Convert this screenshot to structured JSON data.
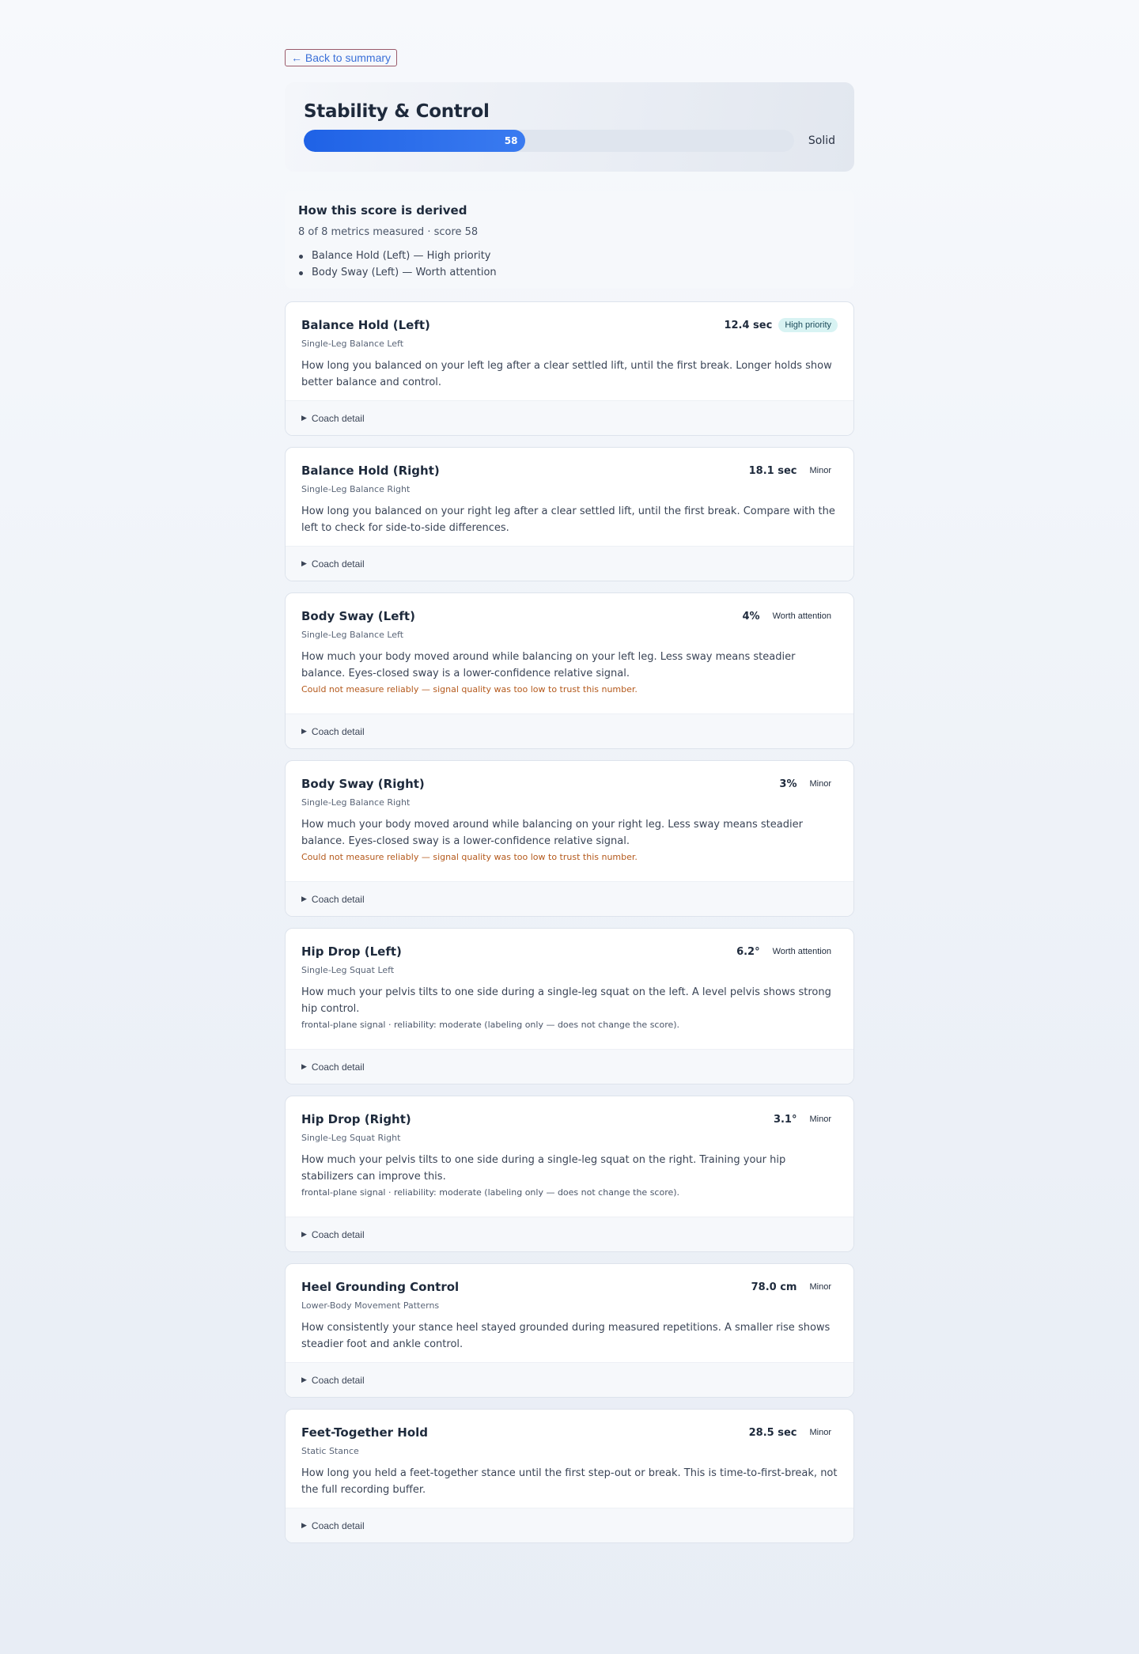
{
  "nav": {
    "back_label": "← Back to summary"
  },
  "hero": {
    "title": "Stability & Control",
    "score": 58,
    "score_label": "58",
    "score_fraction": 0.58,
    "rating": "Solid",
    "bar_color": "#2a6ae8"
  },
  "derived": {
    "title": "How this score is derived",
    "summary": "8 of 8 metrics measured · score 58",
    "items": [
      "Balance Hold (Left) — High priority",
      "Body Sway (Left) — Worth attention"
    ]
  },
  "coach_label": "Coach detail",
  "metrics": [
    {
      "title": "Balance Hold (Left)",
      "value": "12.4 sec",
      "badge": "High priority",
      "source": "Single-Leg Balance Left",
      "description": "How long you balanced on your left leg after a clear settled lift, until the first break. Longer holds show better balance and control."
    },
    {
      "title": "Balance Hold (Right)",
      "value": "18.1 sec",
      "badge": "Minor",
      "source": "Single-Leg Balance Right",
      "description": "How long you balanced on your right leg after a clear settled lift, until the first break. Compare with the left to check for side-to-side differences."
    },
    {
      "title": "Body Sway (Left)",
      "value": "4%",
      "badge": "Worth attention",
      "source": "Single-Leg Balance Left",
      "description": "How much your body moved around while balancing on your left leg. Less sway means steadier balance. Eyes-closed sway is a lower-confidence relative signal.",
      "warning": "Could not measure reliably — signal quality was too low to trust this number."
    },
    {
      "title": "Body Sway (Right)",
      "value": "3%",
      "badge": "Minor",
      "source": "Single-Leg Balance Right",
      "description": "How much your body moved around while balancing on your right leg. Less sway means steadier balance. Eyes-closed sway is a lower-confidence relative signal.",
      "warning": "Could not measure reliably — signal quality was too low to trust this number."
    },
    {
      "title": "Hip Drop (Left)",
      "value": "6.2°",
      "badge": "Worth attention",
      "source": "Single-Leg Squat Left",
      "description": "How much your pelvis tilts to one side during a single-leg squat on the left. A level pelvis shows strong hip control.",
      "note": "frontal-plane signal · reliability: moderate (labeling only — does not change the score)."
    },
    {
      "title": "Hip Drop (Right)",
      "value": "3.1°",
      "badge": "Minor",
      "source": "Single-Leg Squat Right",
      "description": "How much your pelvis tilts to one side during a single-leg squat on the right. Training your hip stabilizers can improve this.",
      "note": "frontal-plane signal · reliability: moderate (labeling only — does not change the score)."
    },
    {
      "title": "Heel Grounding Control",
      "value": "78.0 cm",
      "badge": "Minor",
      "source": "Lower-Body Movement Patterns",
      "description": "How consistently your stance heel stayed grounded during measured repetitions. A smaller rise shows steadier foot and ankle control."
    },
    {
      "title": "Feet-Together Hold",
      "value": "28.5 sec",
      "badge": "Minor",
      "source": "Static Stance",
      "description": "How long you held a feet-together stance until the first step-out or break. This is time-to-first-break, not the full recording buffer."
    }
  ]
}
